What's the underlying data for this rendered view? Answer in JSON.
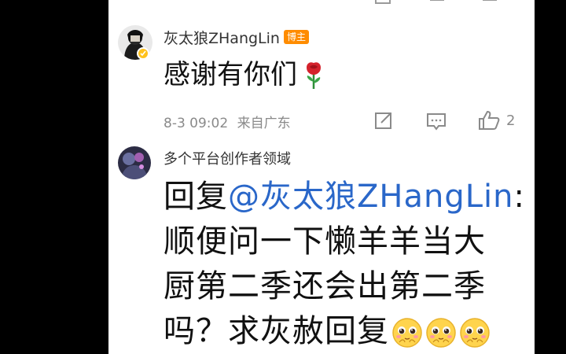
{
  "colors": {
    "link": "#2a67c9",
    "badge": "#ff8c00",
    "meta": "#8a8a8a",
    "text": "#111111"
  },
  "top_strip": {
    "partial_text": "",
    "icons": [
      "share-icon",
      "comment-icon",
      "like-icon"
    ]
  },
  "first_comment": {
    "author": "灰太狼ZHangLin",
    "badge": "博主",
    "verified": true,
    "text": "感谢有你们",
    "emoji": "rose-icon",
    "date_time": "8-3 09:02",
    "location": "来自广东",
    "actions": {
      "share_icon": "share-icon",
      "comment_icon": "comment-icon",
      "like_icon": "like-icon",
      "like_count": "2"
    }
  },
  "reply": {
    "author": "多个平台创作者领域",
    "prefix": "回复",
    "mention": "@灰太狼ZHangLin",
    "colon": ":",
    "line2": "顺便问一下懒羊羊当大",
    "line3": "厨第二季还会出第二季",
    "line4_text": "吗？求灰赦回复",
    "emojis": [
      "pleading-face-icon",
      "pleading-face-icon",
      "pleading-face-icon"
    ]
  }
}
